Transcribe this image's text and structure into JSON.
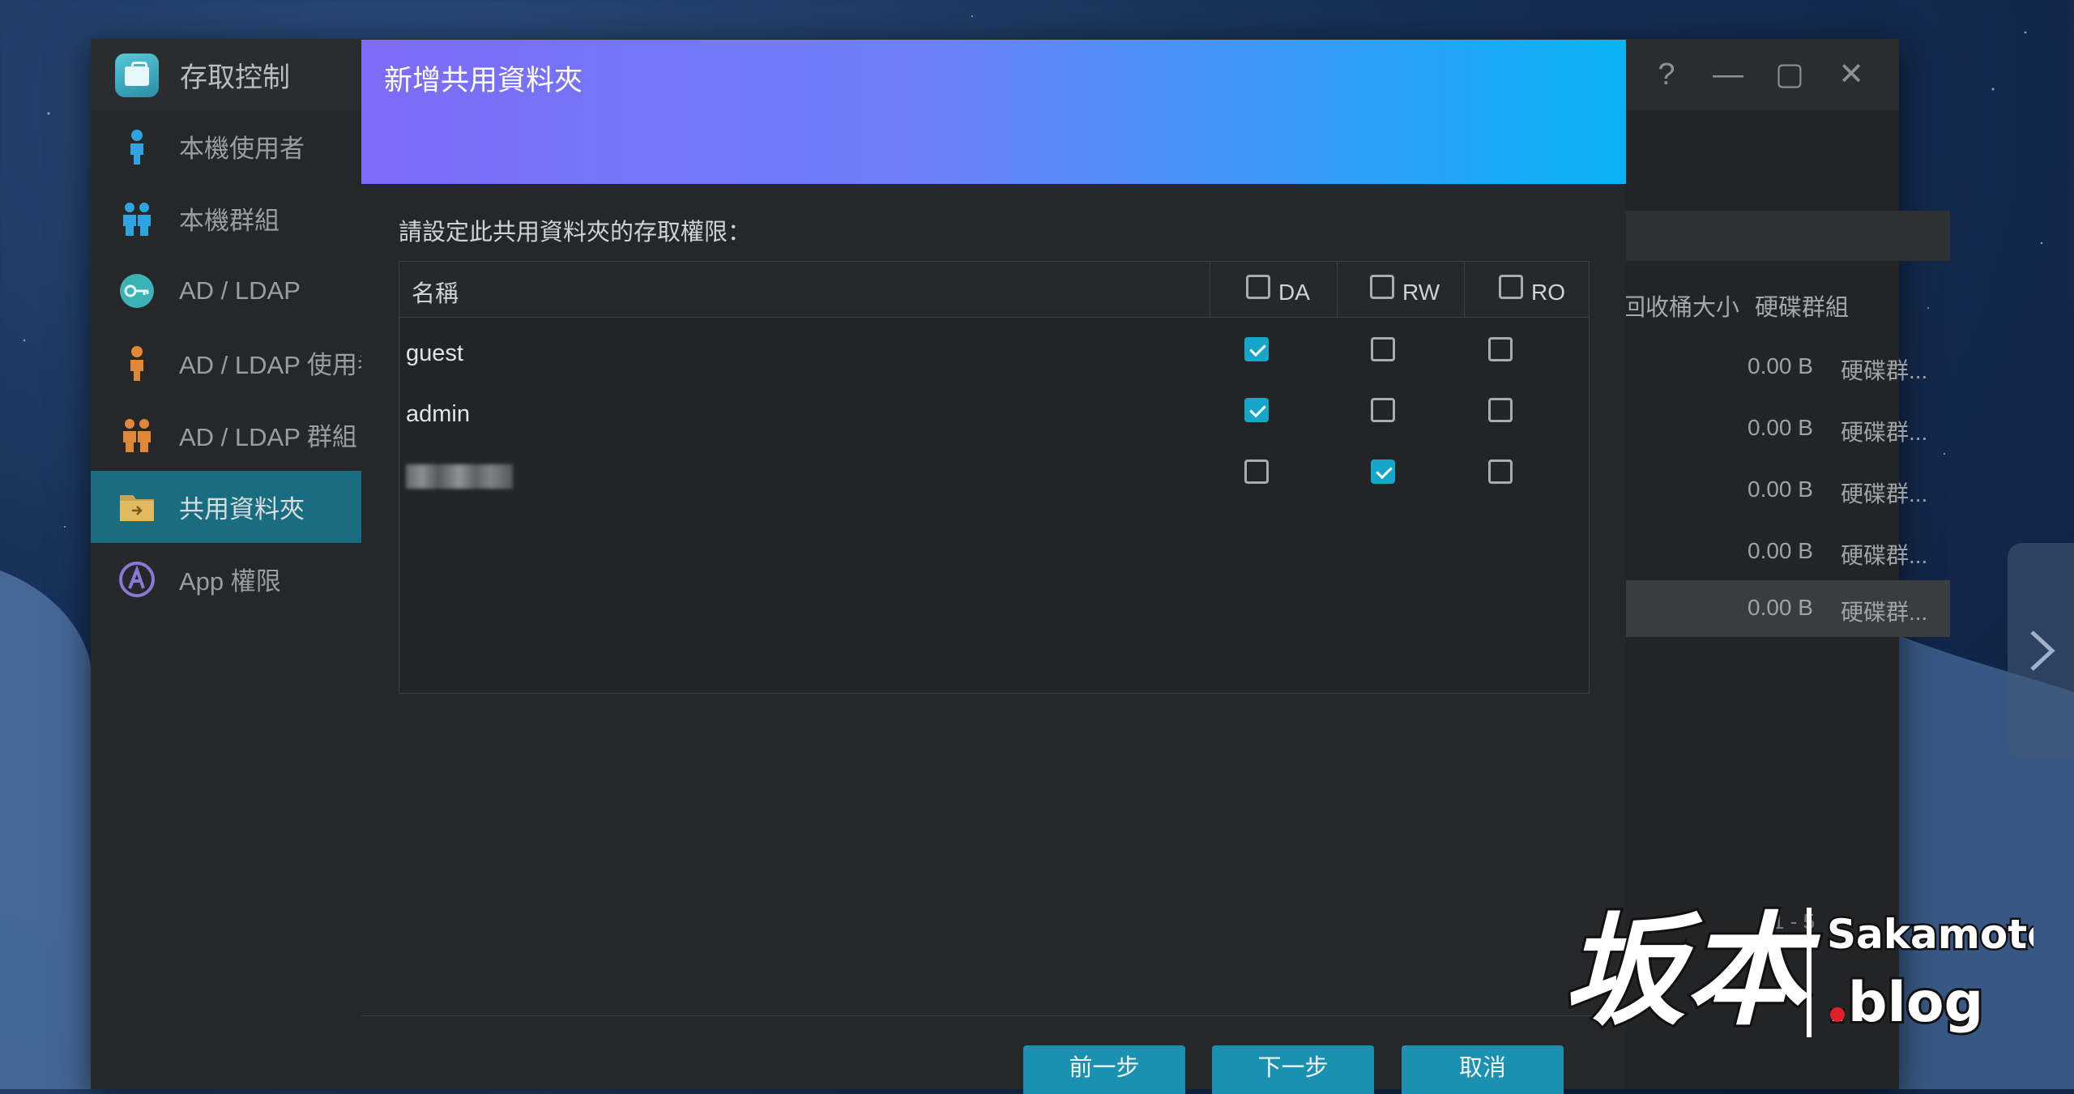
{
  "window": {
    "title": "存取控制",
    "controls": [
      "?",
      "—",
      "▢",
      "✕"
    ]
  },
  "sidebar": {
    "items": [
      {
        "label": "本機使用者",
        "icon": "user-icon",
        "active": false
      },
      {
        "label": "本機群組",
        "icon": "group-icon",
        "active": false
      },
      {
        "label": "AD / LDAP",
        "icon": "key-icon",
        "active": false
      },
      {
        "label": "AD / LDAP 使用者",
        "icon": "ad-user-icon",
        "active": false
      },
      {
        "label": "AD / LDAP 群組",
        "icon": "ad-group-icon",
        "active": false
      },
      {
        "label": "共用資料夾",
        "icon": "folder-icon",
        "active": true
      },
      {
        "label": "App 權限",
        "icon": "app-permission-icon",
        "active": false
      }
    ]
  },
  "background_table": {
    "headers": {
      "recycle": "回收桶大小",
      "disk_group": "硬碟群組"
    },
    "rows": [
      {
        "size": "0.00 B",
        "group": "硬碟群..."
      },
      {
        "size": "0.00 B",
        "group": "硬碟群..."
      },
      {
        "size": "0.00 B",
        "group": "硬碟群..."
      },
      {
        "size": "0.00 B",
        "group": "硬碟群..."
      },
      {
        "size": "0.00 B",
        "group": "硬碟群..."
      }
    ],
    "pagination": "1 - 5"
  },
  "modal": {
    "title": "新增共用資料夾",
    "prompt": "請設定此共用資料夾的存取權限：",
    "columns": {
      "name": "名稱",
      "da": "DA",
      "rw": "RW",
      "ro": "RO"
    },
    "rows": [
      {
        "name": "guest",
        "da": true,
        "rw": false,
        "ro": false,
        "blurred": false
      },
      {
        "name": "admin",
        "da": true,
        "rw": false,
        "ro": false,
        "blurred": false
      },
      {
        "name": "",
        "da": false,
        "rw": true,
        "ro": false,
        "blurred": true
      }
    ],
    "buttons": {
      "prev": "前一步",
      "next": "下一步",
      "cancel": "取消"
    }
  },
  "watermark": {
    "text_cn": "坂本",
    "text_en_top": "Sakamoto",
    "text_en_bottom": ".blog"
  },
  "colors": {
    "accent": "#16a7c8",
    "header_gradient_start": "#7c6cf6",
    "header_gradient_end": "#08b2f5",
    "sidebar_active": "#1a6d80"
  }
}
